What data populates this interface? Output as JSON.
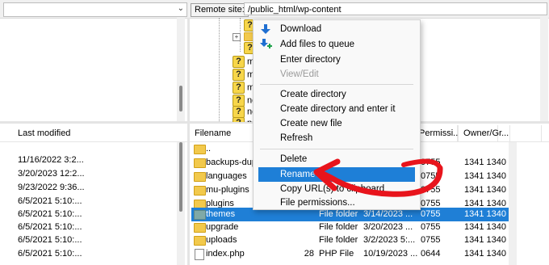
{
  "remote_site": {
    "label": "Remote site:",
    "path": "/public_html/wp-content"
  },
  "tree": {
    "items": [
      {
        "label": ""
      },
      {
        "label": ""
      },
      {
        "label": ""
      },
      {
        "label": "my"
      },
      {
        "label": "my"
      },
      {
        "label": "my"
      },
      {
        "label": "ne"
      },
      {
        "label": "ne"
      },
      {
        "label": "ne"
      }
    ]
  },
  "local_list": {
    "header": "Last modified",
    "dates": [
      "",
      "11/16/2022 3:2...",
      "3/20/2023 12:2...",
      "9/23/2022 9:36...",
      "6/5/2021 5:10:...",
      "6/5/2021 5:10:...",
      "6/5/2021 5:10:...",
      "6/5/2021 5:10:...",
      "6/5/2021 5:10:..."
    ]
  },
  "remote_list": {
    "headers": {
      "filename": "Filename",
      "permissions": "Permissi...",
      "owner": "Owner/Gr..."
    },
    "rows": [
      {
        "name": "..",
        "size": "",
        "type": "",
        "modified": "",
        "perm": "",
        "owner": "",
        "icon": "folder"
      },
      {
        "name": "backups-dup",
        "size": "",
        "type": "",
        "modified": "",
        "perm": "0755",
        "owner": "1341 1340",
        "icon": "folder"
      },
      {
        "name": "languages",
        "size": "",
        "type": "",
        "modified": "",
        "perm": "0755",
        "owner": "1341 1340",
        "icon": "folder"
      },
      {
        "name": "mu-plugins",
        "size": "",
        "type": "",
        "modified": "",
        "perm": "0755",
        "owner": "1341 1340",
        "icon": "folder"
      },
      {
        "name": "plugins",
        "size": "",
        "type": "",
        "modified": "",
        "perm": "0755",
        "owner": "1341 1340",
        "icon": "folder"
      },
      {
        "name": "themes",
        "size": "",
        "type": "File folder",
        "modified": "3/14/2023 ...",
        "perm": "0755",
        "owner": "1341 1340",
        "icon": "folder",
        "selected": true
      },
      {
        "name": "upgrade",
        "size": "",
        "type": "File folder",
        "modified": "3/20/2023 ...",
        "perm": "0755",
        "owner": "1341 1340",
        "icon": "folder"
      },
      {
        "name": "uploads",
        "size": "",
        "type": "File folder",
        "modified": "3/2/2023 5:...",
        "perm": "0755",
        "owner": "1341 1340",
        "icon": "folder"
      },
      {
        "name": "index.php",
        "size": "28",
        "type": "PHP File",
        "modified": "10/19/2023 ...",
        "perm": "0644",
        "owner": "1341 1340",
        "icon": "file"
      }
    ]
  },
  "context_menu": {
    "items": [
      {
        "label": "Download",
        "icon": "download-arrow-icon"
      },
      {
        "label": "Add files to queue",
        "icon": "add-to-queue-icon"
      },
      {
        "label": "Enter directory"
      },
      {
        "label": "View/Edit",
        "disabled": true
      },
      {
        "label": "Create directory"
      },
      {
        "label": "Create directory and enter it"
      },
      {
        "label": "Create new file"
      },
      {
        "label": "Refresh"
      },
      {
        "label": "Delete"
      },
      {
        "label": "Rename",
        "highlighted": true
      },
      {
        "label": "Copy URL(s) to clipboard"
      },
      {
        "label": "File permissions..."
      }
    ]
  },
  "colors": {
    "selection_blue": "#1f7fd6",
    "annotation_red": "#e8141c"
  }
}
